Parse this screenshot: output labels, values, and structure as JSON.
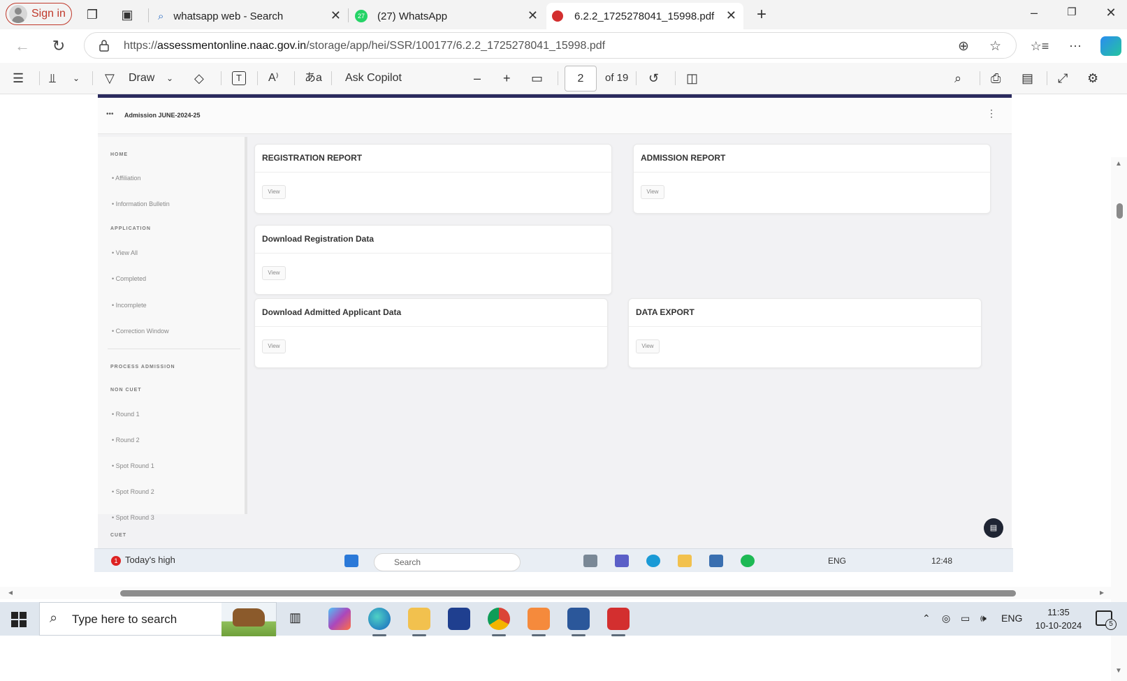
{
  "browser": {
    "signin_label": "Sign in",
    "tabs": [
      {
        "title": "whatsapp web - Search",
        "icon": "search-icon"
      },
      {
        "title": "(27) WhatsApp",
        "icon": "whatsapp-icon",
        "badge": "27"
      },
      {
        "title": "6.2.2_1725278041_15998.pdf",
        "icon": "pdf-icon",
        "active": true
      }
    ],
    "new_tab": "+",
    "url_prefix": "https://",
    "url_host": "assessmentonline.naac.gov.in",
    "url_path": "/storage/app/hei/SSR/100177/6.2.2_1725278041_15998.pdf"
  },
  "pdf_toolbar": {
    "draw_label": "Draw",
    "copilot_label": "Ask Copilot",
    "page_current": "2",
    "page_total": "of 19"
  },
  "pdf_page": {
    "header_title": "Admission JUNE-2024-25",
    "sidebar": {
      "sections": [
        "HOME",
        "APPLICATION",
        "PROCESS ADMISSION",
        "NON CUET",
        "CUET"
      ],
      "home_items": [
        "Affiliation",
        "Information Bulletin"
      ],
      "application_items": [
        "View All",
        "Completed",
        "Incomplete",
        "Correction Window"
      ],
      "noncuet_items": [
        "Round 1",
        "Round 2",
        "Spot Round 1",
        "Spot Round 2",
        "Spot Round 3"
      ]
    },
    "cards": [
      {
        "title": "REGISTRATION REPORT",
        "button": "View"
      },
      {
        "title": "ADMISSION REPORT",
        "button": "View"
      },
      {
        "title": "Download Registration Data",
        "button": "View"
      },
      {
        "title": "Download Admitted Applicant Data",
        "button": "View"
      },
      {
        "title": "DATA EXPORT",
        "button": "View"
      }
    ],
    "embedded_taskbar": {
      "news": "Today's high",
      "news_badge": "1",
      "search": "Search",
      "lang": "ENG",
      "time": "12:48"
    }
  },
  "taskbar": {
    "search_placeholder": "Type here to search",
    "lang": "ENG",
    "time": "11:35",
    "date": "10-10-2024",
    "notif_count": "5"
  },
  "colors": {
    "signin": "#c0392b",
    "page_top_bar": "#2b2b5e",
    "taskbar": "#dfe6ee",
    "pdf_red": "#d32f2f",
    "whatsapp_green": "#25d366"
  }
}
